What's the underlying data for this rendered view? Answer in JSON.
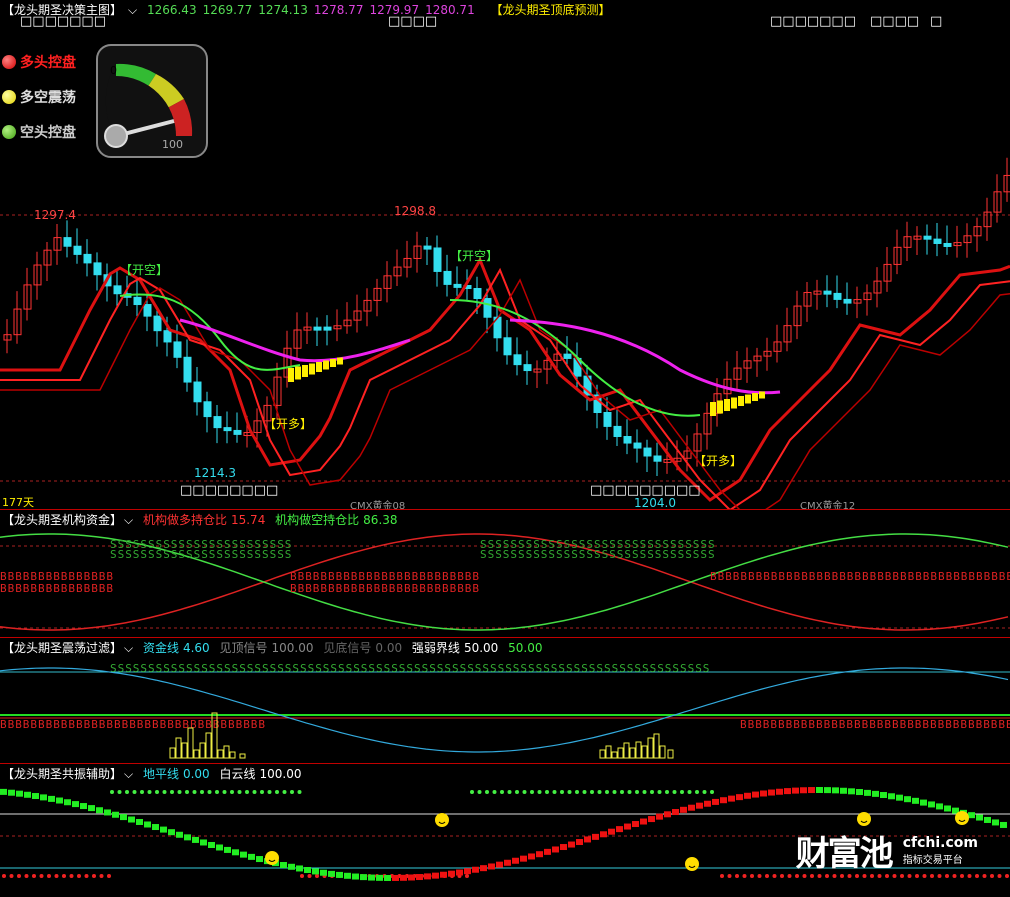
{
  "main": {
    "title": "【龙头期圣决策主图】",
    "values": [
      "1266.43",
      "1269.77",
      "1274.13",
      "1278.77",
      "1279.97",
      "1280.71"
    ],
    "value_colors": [
      "#55dd55",
      "#55dd55",
      "#55dd55",
      "#dd44dd",
      "#dd44dd",
      "#dd44dd"
    ],
    "title2": "【龙头期圣顶底预测】",
    "sub_left": "□□□□□□□",
    "sub_mid": "□□□□",
    "sub_right": [
      "□□□□□□□",
      "□□□□",
      "□"
    ],
    "legend": [
      {
        "label": "多头控盘",
        "color": "#ff2020"
      },
      {
        "label": "多空震荡",
        "color": "#ffee00"
      },
      {
        "label": "空头控盘",
        "color": "#66cc22"
      }
    ],
    "gauge_min": "0",
    "gauge_max": "100",
    "high1": "1297.4",
    "high2": "1298.8",
    "low1": "1214.3",
    "low2": "1204.0",
    "signal_open_short": "【开空】",
    "signal_open_long": "【开多】",
    "bottom_text1": "□□□□□□□□",
    "bottom_text2": "□□□□□□□□□",
    "days": "177天",
    "contract1": "CMX黄金08",
    "contract2": "CMX黄金12"
  },
  "panel2": {
    "title": "【龙头期圣机构资金】",
    "long_label": "机构做多持仓比",
    "long_value": "15.74",
    "short_label": "机构做空持仓比",
    "short_value": "86.38"
  },
  "panel3": {
    "title": "【龙头期圣震荡过滤】",
    "fund_label": "资金线",
    "fund_value": "4.60",
    "top_label": "见顶信号",
    "top_value": "100.00",
    "bottom_label": "见底信号",
    "bottom_value": "0.00",
    "line_label": "强弱界线",
    "line_value": "50.00",
    "extra_value": "50.00"
  },
  "panel4": {
    "title": "【龙头期圣共振辅助】",
    "ground_label": "地平线",
    "ground_value": "0.00",
    "cloud_label": "白云线",
    "cloud_value": "100.00"
  },
  "watermark": {
    "brand": "财富池",
    "domain": "cfchi.com",
    "slogan": "指标交易平台"
  },
  "icons": {
    "dropdown": "chevron-down-icon",
    "gauge": "gauge-icon",
    "smiley": "smiley-icon"
  }
}
